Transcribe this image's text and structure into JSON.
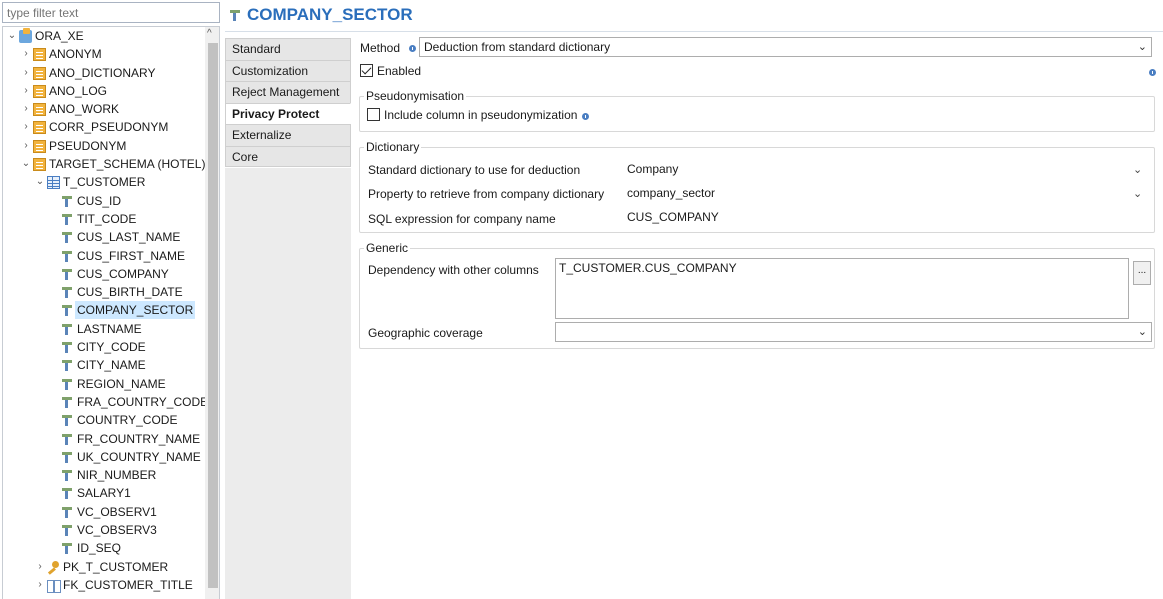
{
  "filter": {
    "placeholder": "type filter text"
  },
  "tree": {
    "items": [
      {
        "label": "ORA_XE",
        "icon": "database-icon",
        "chevron": "v"
      },
      {
        "label": "ANONYM",
        "icon": "schema-icon",
        "chevron": ">"
      },
      {
        "label": "ANO_DICTIONARY",
        "icon": "schema-icon",
        "chevron": ">"
      },
      {
        "label": "ANO_LOG",
        "icon": "schema-icon",
        "chevron": ">"
      },
      {
        "label": "ANO_WORK",
        "icon": "schema-icon",
        "chevron": ">"
      },
      {
        "label": "CORR_PSEUDONYM",
        "icon": "schema-icon",
        "chevron": ">"
      },
      {
        "label": "PSEUDONYM",
        "icon": "schema-icon",
        "chevron": ">"
      },
      {
        "label": "TARGET_SCHEMA (HOTEL)",
        "icon": "schema-icon",
        "chevron": "v"
      },
      {
        "label": "T_CUSTOMER",
        "icon": "table-icon",
        "chevron": "v"
      },
      {
        "label": "CUS_ID",
        "icon": "column-icon"
      },
      {
        "label": "TIT_CODE",
        "icon": "column-icon"
      },
      {
        "label": "CUS_LAST_NAME",
        "icon": "column-icon"
      },
      {
        "label": "CUS_FIRST_NAME",
        "icon": "column-icon"
      },
      {
        "label": "CUS_COMPANY",
        "icon": "column-icon"
      },
      {
        "label": "CUS_BIRTH_DATE",
        "icon": "column-icon"
      },
      {
        "label": "COMPANY_SECTOR",
        "icon": "column-icon",
        "selected": true
      },
      {
        "label": "LASTNAME",
        "icon": "column-icon"
      },
      {
        "label": "CITY_CODE",
        "icon": "column-icon"
      },
      {
        "label": "CITY_NAME",
        "icon": "column-icon"
      },
      {
        "label": "REGION_NAME",
        "icon": "column-icon"
      },
      {
        "label": "FRA_COUNTRY_CODE",
        "icon": "column-icon"
      },
      {
        "label": "COUNTRY_CODE",
        "icon": "column-icon"
      },
      {
        "label": "FR_COUNTRY_NAME",
        "icon": "column-icon"
      },
      {
        "label": "UK_COUNTRY_NAME",
        "icon": "column-icon"
      },
      {
        "label": "NIR_NUMBER",
        "icon": "column-icon"
      },
      {
        "label": "SALARY1",
        "icon": "column-icon"
      },
      {
        "label": "VC_OBSERV1",
        "icon": "column-icon"
      },
      {
        "label": "VC_OBSERV3",
        "icon": "column-icon"
      },
      {
        "label": "ID_SEQ",
        "icon": "column-icon"
      },
      {
        "label": "PK_T_CUSTOMER",
        "icon": "primary-key-icon",
        "chevron": ">"
      },
      {
        "label": "FK_CUSTOMER_TITLE",
        "icon": "foreign-key-icon",
        "chevron": ">"
      }
    ]
  },
  "header": {
    "title": "COMPANY_SECTOR",
    "icon": "column-icon"
  },
  "tabs": [
    {
      "label": "Standard"
    },
    {
      "label": "Customization"
    },
    {
      "label": "Reject Management"
    },
    {
      "label": "Privacy Protect",
      "active": true
    },
    {
      "label": "Externalize"
    },
    {
      "label": "Core"
    }
  ],
  "form": {
    "method_label": "Method",
    "method_value": "Deduction from standard dictionary",
    "enabled_label": "Enabled",
    "enabled_checked": true,
    "pseudo_group": "Pseudonymisation",
    "pseudo_include_label": "Include column in pseudonymization",
    "pseudo_include_checked": false,
    "dict_group": "Dictionary",
    "dict_std_label": "Standard dictionary to use for deduction",
    "dict_std_value": "Company",
    "dict_prop_label": "Property to retrieve from company dictionary",
    "dict_prop_value": "company_sector",
    "dict_sql_label": "SQL expression for company name",
    "dict_sql_value": "CUS_COMPANY",
    "generic_group": "Generic",
    "dep_label": "Dependency with other columns",
    "dep_value": "T_CUSTOMER.CUS_COMPANY",
    "dep_button": "...",
    "geo_label": "Geographic coverage",
    "geo_value": ""
  }
}
